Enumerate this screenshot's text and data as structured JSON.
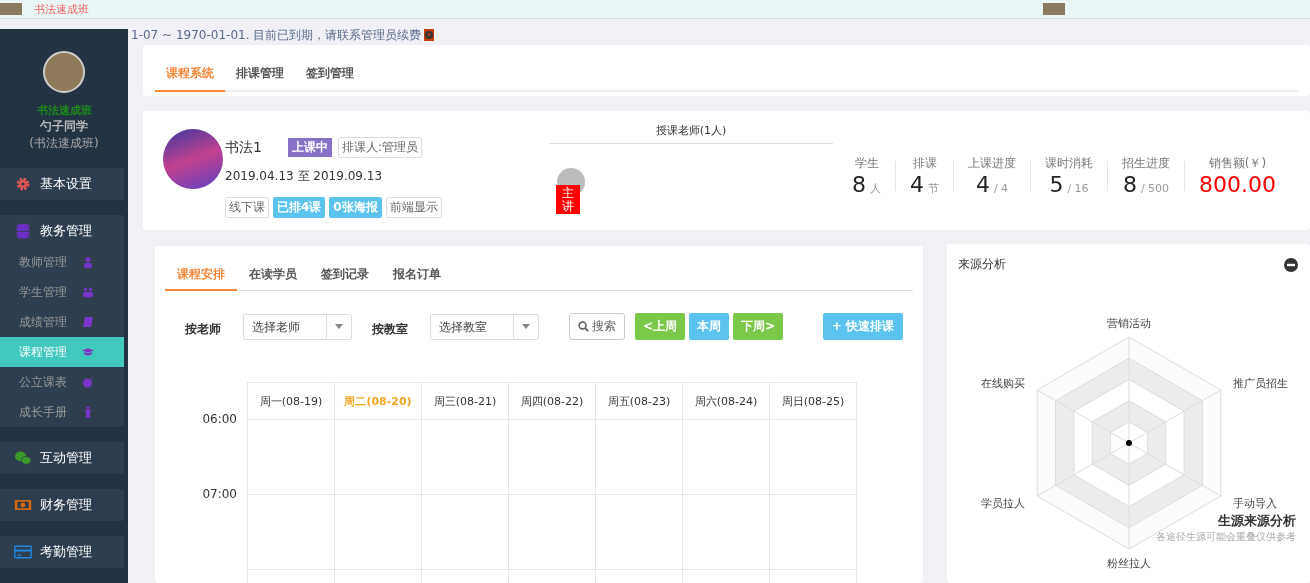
{
  "top_bar": {
    "school_name": "书法速成班"
  },
  "notice": {
    "text": "1-07 ~ 1970-01-01. 目前已到期，请联系管理员续费"
  },
  "sidebar": {
    "school": "书法速成班",
    "user": "勺子同学",
    "class_name": "(书法速成班)",
    "menu": [
      {
        "label": "基本设置",
        "kind": "settings"
      },
      {
        "label": "教务管理",
        "kind": "database",
        "children": [
          {
            "label": "教师管理",
            "kind": "user",
            "selected": false
          },
          {
            "label": "学生管理",
            "kind": "users",
            "selected": false
          },
          {
            "label": "成绩管理",
            "kind": "book",
            "selected": false
          },
          {
            "label": "课程管理",
            "kind": "cap",
            "selected": true
          },
          {
            "label": "公立课表",
            "kind": "bomb",
            "selected": false
          },
          {
            "label": "成长手册",
            "kind": "child",
            "selected": false
          }
        ]
      },
      {
        "label": "互动管理",
        "kind": "chat"
      },
      {
        "label": "财务管理",
        "kind": "money"
      },
      {
        "label": "考勤管理",
        "kind": "card"
      }
    ]
  },
  "tabs": [
    {
      "label": "课程系统",
      "selected": true
    },
    {
      "label": "排课管理",
      "selected": false
    },
    {
      "label": "签到管理",
      "selected": false
    }
  ],
  "course": {
    "title": "书法1",
    "status": "上课中",
    "scheduler": "排课人:管理员",
    "dates": "2019.04.13 至 2019.09.13",
    "tags": [
      {
        "label": "线下课",
        "kind": "outline"
      },
      {
        "label": "已排4课",
        "kind": "filled"
      },
      {
        "label": "0张海报",
        "kind": "filled"
      },
      {
        "label": "前端显示",
        "kind": "outline"
      }
    ],
    "teachers_title": "授课老师(1人)",
    "teacher_badge": "主讲",
    "stats": [
      {
        "label": "学生",
        "value": "8",
        "unit": "人",
        "kind": "count"
      },
      {
        "label": "排课",
        "value": "4",
        "unit": "节",
        "kind": "count"
      },
      {
        "label": "上课进度",
        "value": "4",
        "unit": "/ 4",
        "kind": "count"
      },
      {
        "label": "课时消耗",
        "value": "5",
        "unit": "/ 16",
        "kind": "count"
      },
      {
        "label": "招生进度",
        "value": "8",
        "unit": "/ 500",
        "kind": "count"
      },
      {
        "label": "销售额(￥)",
        "value": "800.00",
        "kind": "money"
      }
    ]
  },
  "schedule": {
    "tabs": [
      {
        "label": "课程安排",
        "selected": true
      },
      {
        "label": "在读学员",
        "selected": false
      },
      {
        "label": "签到记录",
        "selected": false
      },
      {
        "label": "报名订单",
        "selected": false
      }
    ],
    "filters": [
      {
        "label": "按老师",
        "placeholder": "选择老师"
      },
      {
        "label": "按教室",
        "placeholder": "选择教室"
      }
    ],
    "search_button": "搜索",
    "week_buttons": [
      {
        "label": "<上周",
        "kind": "green"
      },
      {
        "label": "本周",
        "kind": "blue"
      },
      {
        "label": "下周>",
        "kind": "green"
      }
    ],
    "quick_button": "+ 快速排课",
    "days": [
      {
        "label": "周一(08-19)",
        "selected": false
      },
      {
        "label": "周二(08-20)",
        "selected": true
      },
      {
        "label": "周三(08-21)",
        "selected": false
      },
      {
        "label": "周四(08-22)",
        "selected": false
      },
      {
        "label": "周五(08-23)",
        "selected": false
      },
      {
        "label": "周六(08-24)",
        "selected": false
      },
      {
        "label": "周日(08-25)",
        "selected": false
      }
    ],
    "times": [
      "06:00",
      "07:00"
    ]
  },
  "radar": {
    "title": "来源分析",
    "axes": [
      "营销活动",
      "推广员招生",
      "手动导入",
      "粉丝拉人",
      "学员拉人",
      "在线购买"
    ],
    "caption_title": "生源来源分析",
    "caption_sub": "各途径生源可能会重叠仅供参考"
  }
}
